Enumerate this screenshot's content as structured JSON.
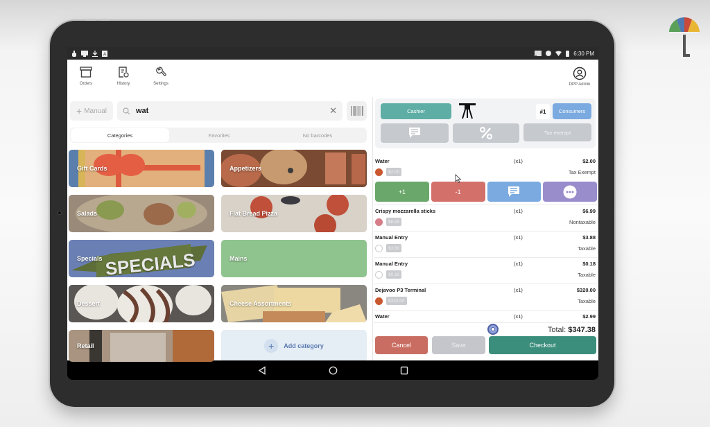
{
  "status_bar": {
    "left_icons": [
      "notification-icon",
      "cast-screen-icon",
      "download-icon",
      "a-badge-icon"
    ],
    "right_icons": [
      "cast-icon",
      "do-not-disturb-icon",
      "wifi-icon",
      "battery-icon"
    ],
    "time": "6:30 PM"
  },
  "top_nav": {
    "items": [
      {
        "label": "Orders",
        "icon": "archive-box-icon"
      },
      {
        "label": "History",
        "icon": "receipt-history-icon"
      },
      {
        "label": "Settings",
        "icon": "wrench-gear-icon"
      }
    ],
    "user": {
      "label": "DPP Admin",
      "icon": "user-circle-icon"
    }
  },
  "search": {
    "manual_label": "Manual",
    "value": "wat",
    "clear_icon": "close-icon",
    "barcode_icon": "barcode-icon"
  },
  "tabs": [
    {
      "label": "Categories",
      "active": true
    },
    {
      "label": "Favorites",
      "active": false
    },
    {
      "label": "No barcodes",
      "active": false
    }
  ],
  "categories": [
    {
      "label": "Gift Cards"
    },
    {
      "label": "Appetizers"
    },
    {
      "label": "Salads"
    },
    {
      "label": "Flat Bread Pizza"
    },
    {
      "label": "Specials",
      "banner_text": "SPECIALS"
    },
    {
      "label": "Mains"
    },
    {
      "label": "Dessert"
    },
    {
      "label": "Cheese Assortments"
    },
    {
      "label": "Retail"
    }
  ],
  "add_category_label": "Add category",
  "order_controls": {
    "cashier_label": "Cashier",
    "table_icon": "table-icon",
    "ticket_number": "#1",
    "consumers_label": "Consumers",
    "note_icon": "comment-icon",
    "discount_icon": "percent-icon",
    "tax_exempt_label": "Tax exempt"
  },
  "order_items": [
    {
      "name": "Water",
      "qty": "(x1)",
      "price": "$2.00",
      "unit_price": "$2.00",
      "tax": "Tax Exempt",
      "dot_color": "#c9582e"
    },
    {
      "name": "Crispy mozzarella sticks",
      "qty": "(x1)",
      "price": "$6.99",
      "unit_price": "$6.99",
      "tax": "Nontaxable",
      "dot_color": "#d77d8a"
    },
    {
      "name": "Manual Entry",
      "qty": "(x1)",
      "price": "$3.88",
      "unit_price": "$3.88",
      "tax": "Taxable",
      "dot_color": ""
    },
    {
      "name": "Manual Entry",
      "qty": "(x1)",
      "price": "$0.18",
      "unit_price": "$0.18",
      "tax": "Taxable",
      "dot_color": ""
    },
    {
      "name": "Dejavoo P3 Terminal",
      "qty": "(x1)",
      "price": "$320.00",
      "unit_price": "$320.00",
      "tax": "Taxable",
      "dot_color": "#c9582e"
    },
    {
      "name": "Water",
      "qty": "(x1)",
      "price": "$2.99",
      "unit_price": "",
      "tax": "",
      "dot_color": ""
    }
  ],
  "item_actions": {
    "plus_label": "+1",
    "minus_label": "-1",
    "note_icon": "comment-icon",
    "more_icon": "more-dots-icon"
  },
  "total": {
    "label": "Total:",
    "value": "$347.38"
  },
  "footer": {
    "cancel_label": "Cancel",
    "save_label": "Save",
    "checkout_label": "Checkout"
  },
  "colors": {
    "cashier": "#5eaea5",
    "consumers": "#7aaae0",
    "plus": "#6aa76a",
    "minus": "#d4706a",
    "note": "#7aaae0",
    "more": "#9a8dcc",
    "cancel": "#c96d62",
    "checkout": "#3b8e7c"
  }
}
